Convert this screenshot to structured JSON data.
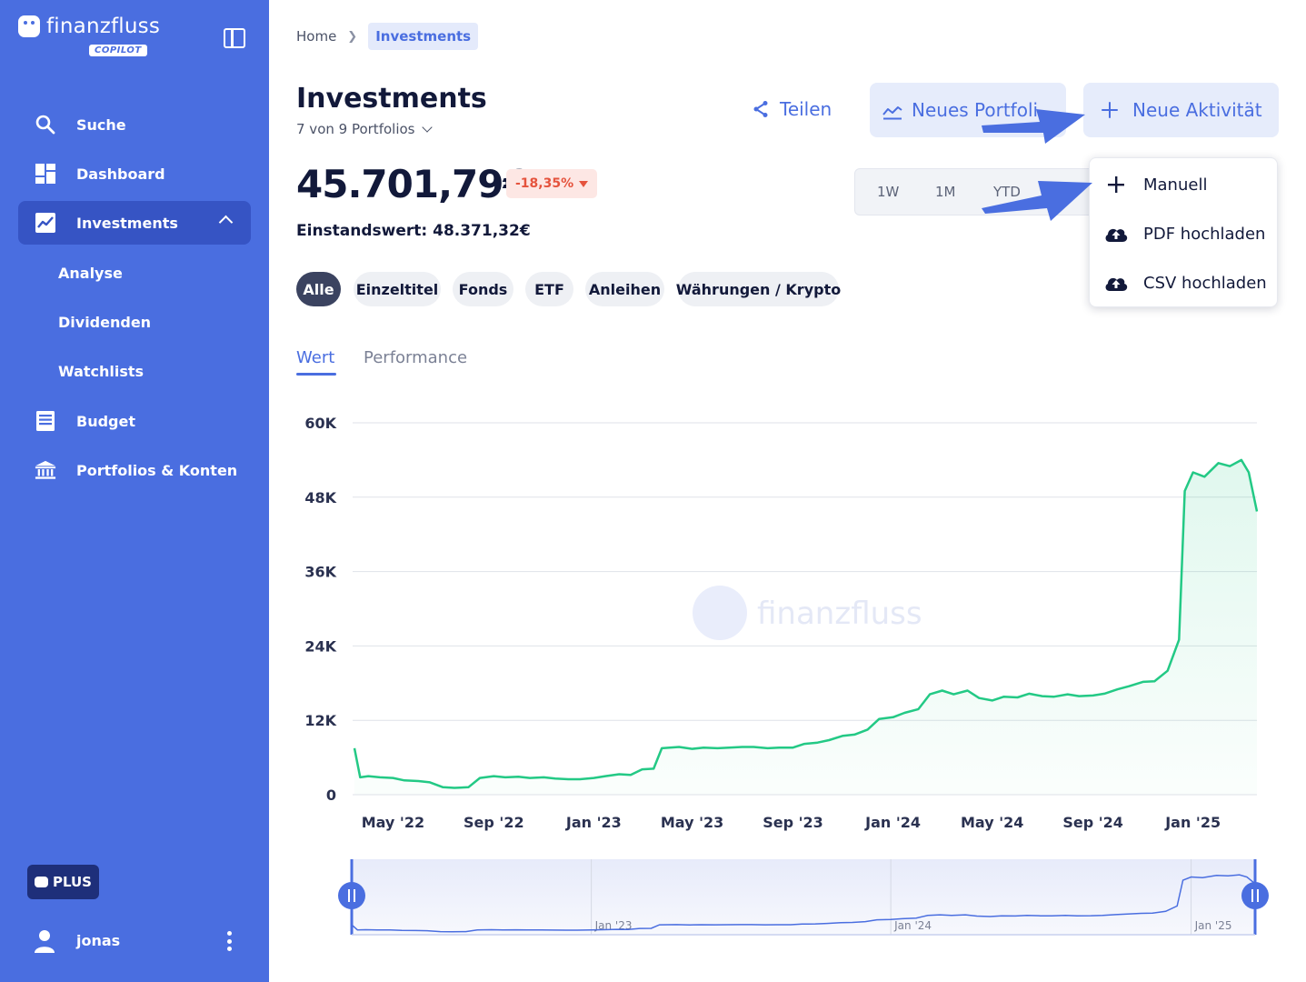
{
  "brand": {
    "name": "finanzfluss",
    "badge": "COPILOT"
  },
  "sidebar": {
    "items": [
      {
        "label": "Suche",
        "icon": "search-icon"
      },
      {
        "label": "Dashboard",
        "icon": "dashboard-icon"
      },
      {
        "label": "Investments",
        "icon": "trending-up-icon",
        "active": true
      },
      {
        "label": "Budget",
        "icon": "budget-icon"
      },
      {
        "label": "Portfolios & Konten",
        "icon": "bank-icon"
      }
    ],
    "subitems": [
      "Analyse",
      "Dividenden",
      "Watchlists"
    ],
    "plus_label": "PLUS",
    "user": "jonas"
  },
  "breadcrumb": {
    "home": "Home",
    "current": "Investments"
  },
  "header": {
    "title": "Investments",
    "portfolio_select": "7 von 9 Portfolios",
    "value": "45.701,79€",
    "change": "-18,35%",
    "einstand": "Einstandswert: 48.371,32€",
    "share_label": "Teilen",
    "new_portfolio_label": "Neues Portfoli",
    "new_activity_label": "Neue Aktivität"
  },
  "ranges": [
    "1W",
    "1M",
    "YTD"
  ],
  "dropdown": [
    {
      "label": "Manuell",
      "icon": "plus-icon"
    },
    {
      "label": "PDF hochladen",
      "icon": "cloud-upload-icon"
    },
    {
      "label": "CSV hochladen",
      "icon": "cloud-upload-icon"
    }
  ],
  "filters": [
    "Alle",
    "Einzeltitel",
    "Fonds",
    "ETF",
    "Anleihen",
    "Währungen / Krypto"
  ],
  "active_filter": "Alle",
  "tabs": [
    "Wert",
    "Performance"
  ],
  "active_tab": "Wert",
  "colors": {
    "sidebar": "#4a6ee0",
    "accent": "#4a6ee0",
    "line": "#23c985",
    "negative": "#e5533d"
  },
  "chart_data": {
    "type": "area",
    "watermark": "finanzfluss",
    "y_ticks": [
      "60K",
      "48K",
      "36K",
      "24K",
      "12K",
      "0"
    ],
    "y_tick_values": [
      60000,
      48000,
      36000,
      24000,
      12000,
      0
    ],
    "ylim": [
      0,
      60000
    ],
    "x_tick_labels": [
      "May '22",
      "Sep '22",
      "Jan '23",
      "May '23",
      "Sep '23",
      "Jan '24",
      "May '24",
      "Sep '24",
      "Jan '25"
    ],
    "x_tick_dates": [
      "2022-05-01",
      "2022-09-01",
      "2023-01-01",
      "2023-05-01",
      "2023-09-01",
      "2024-01-01",
      "2024-05-01",
      "2024-09-01",
      "2025-01-01"
    ],
    "xlim": [
      "2022-03-15",
      "2025-03-20"
    ],
    "grid": true,
    "series": [
      {
        "points": [
          [
            "2022-03-15",
            7500
          ],
          [
            "2022-03-22",
            2800
          ],
          [
            "2022-04-01",
            3000
          ],
          [
            "2022-04-15",
            2800
          ],
          [
            "2022-05-01",
            2700
          ],
          [
            "2022-05-15",
            2300
          ],
          [
            "2022-06-01",
            2200
          ],
          [
            "2022-06-15",
            2000
          ],
          [
            "2022-07-01",
            1200
          ],
          [
            "2022-07-15",
            1100
          ],
          [
            "2022-08-01",
            1200
          ],
          [
            "2022-08-15",
            2700
          ],
          [
            "2022-09-01",
            3000
          ],
          [
            "2022-09-15",
            2800
          ],
          [
            "2022-10-01",
            2900
          ],
          [
            "2022-10-15",
            2700
          ],
          [
            "2022-11-01",
            2800
          ],
          [
            "2022-11-15",
            2600
          ],
          [
            "2022-12-01",
            2500
          ],
          [
            "2022-12-15",
            2500
          ],
          [
            "2023-01-01",
            2700
          ],
          [
            "2023-01-15",
            3000
          ],
          [
            "2023-02-01",
            3300
          ],
          [
            "2023-02-15",
            3200
          ],
          [
            "2023-03-01",
            4100
          ],
          [
            "2023-03-15",
            4200
          ],
          [
            "2023-03-25",
            7500
          ],
          [
            "2023-04-15",
            7700
          ],
          [
            "2023-05-01",
            7400
          ],
          [
            "2023-05-15",
            7600
          ],
          [
            "2023-06-01",
            7500
          ],
          [
            "2023-06-15",
            7600
          ],
          [
            "2023-07-01",
            7700
          ],
          [
            "2023-07-15",
            7700
          ],
          [
            "2023-08-01",
            7500
          ],
          [
            "2023-08-15",
            7600
          ],
          [
            "2023-09-01",
            7600
          ],
          [
            "2023-09-15",
            8200
          ],
          [
            "2023-10-01",
            8400
          ],
          [
            "2023-10-15",
            8800
          ],
          [
            "2023-11-01",
            9500
          ],
          [
            "2023-11-15",
            9700
          ],
          [
            "2023-12-01",
            10500
          ],
          [
            "2023-12-15",
            12200
          ],
          [
            "2024-01-01",
            12500
          ],
          [
            "2024-01-15",
            13200
          ],
          [
            "2024-02-01",
            13800
          ],
          [
            "2024-02-15",
            16200
          ],
          [
            "2024-03-01",
            16800
          ],
          [
            "2024-03-15",
            16200
          ],
          [
            "2024-04-01",
            16800
          ],
          [
            "2024-04-15",
            15600
          ],
          [
            "2024-05-01",
            15200
          ],
          [
            "2024-05-15",
            15800
          ],
          [
            "2024-06-01",
            15700
          ],
          [
            "2024-06-15",
            16300
          ],
          [
            "2024-07-01",
            15900
          ],
          [
            "2024-07-15",
            15800
          ],
          [
            "2024-08-01",
            16200
          ],
          [
            "2024-08-15",
            15900
          ],
          [
            "2024-09-01",
            16000
          ],
          [
            "2024-09-15",
            16300
          ],
          [
            "2024-10-01",
            17000
          ],
          [
            "2024-10-15",
            17500
          ],
          [
            "2024-11-01",
            18200
          ],
          [
            "2024-11-15",
            18300
          ],
          [
            "2024-12-01",
            20000
          ],
          [
            "2024-12-15",
            25000
          ],
          [
            "2024-12-22",
            49000
          ],
          [
            "2025-01-01",
            52000
          ],
          [
            "2025-01-15",
            51300
          ],
          [
            "2025-02-01",
            53500
          ],
          [
            "2025-02-15",
            53000
          ],
          [
            "2025-03-01",
            54000
          ],
          [
            "2025-03-10",
            52000
          ],
          [
            "2025-03-20",
            45700
          ]
        ]
      }
    ],
    "navigator_labels": [
      "Jan '23",
      "Jan '24",
      "Jan '25"
    ],
    "navigator_dates": [
      "2023-01-01",
      "2024-01-01",
      "2025-01-01"
    ]
  }
}
